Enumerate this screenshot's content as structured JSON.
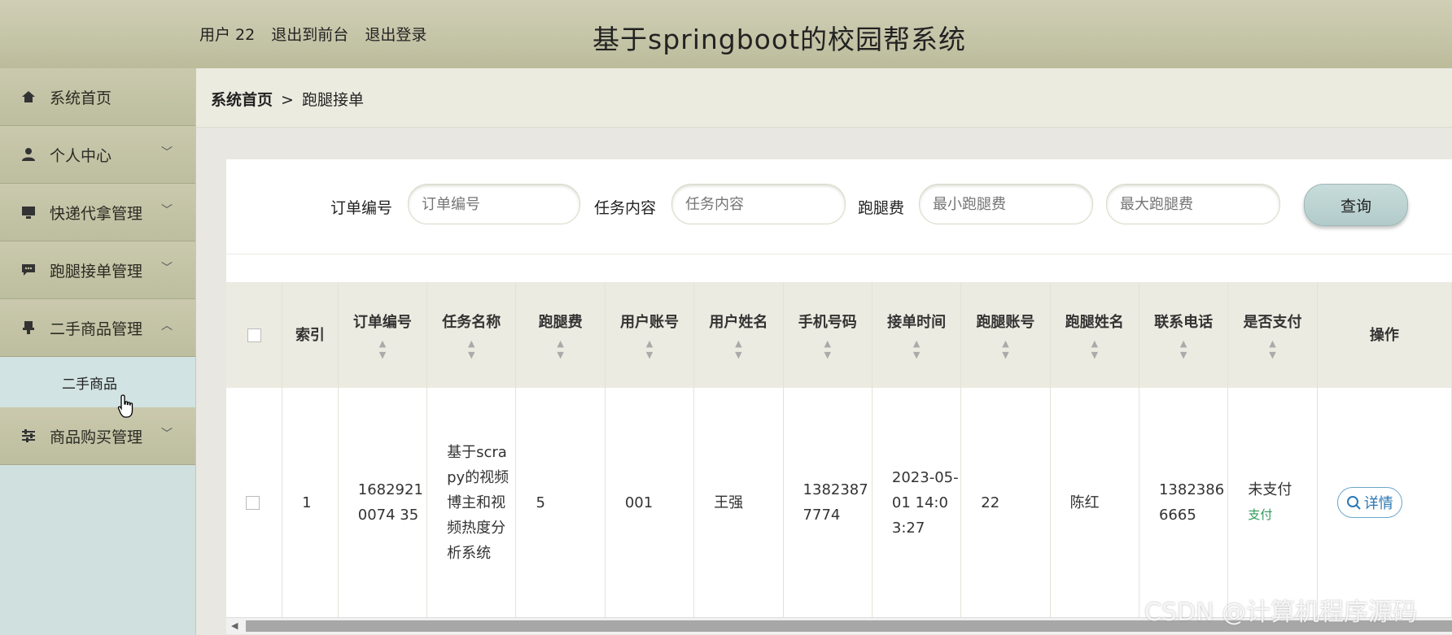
{
  "header": {
    "user_label": "用户 22",
    "back_to_front": "退出到前台",
    "logout": "退出登录",
    "site_title": "基于springboot的校园帮系统"
  },
  "sidebar": {
    "items": [
      {
        "label": "系统首页",
        "icon": "home-icon"
      },
      {
        "label": "个人中心",
        "icon": "user-icon"
      },
      {
        "label": "快递代拿管理",
        "icon": "monitor-icon"
      },
      {
        "label": "跑腿接单管理",
        "icon": "chat-icon"
      },
      {
        "label": "二手商品管理",
        "icon": "stamp-icon"
      },
      {
        "label": "商品购买管理",
        "icon": "sliders-icon"
      }
    ],
    "sub_item": "二手商品"
  },
  "breadcrumb": {
    "home": "系统首页",
    "sep": ">",
    "current": "跑腿接单"
  },
  "search": {
    "order_label": "订单编号",
    "order_placeholder": "订单编号",
    "task_label": "任务内容",
    "task_placeholder": "任务内容",
    "fee_label": "跑腿费",
    "fee_min_placeholder": "最小跑腿费",
    "fee_max_placeholder": "最大跑腿费",
    "query_button": "查询"
  },
  "table": {
    "headers": {
      "index": "索引",
      "order_no": "订单编号",
      "task_name": "任务名称",
      "fee": "跑腿费",
      "user_account": "用户账号",
      "user_name": "用户姓名",
      "phone": "手机号码",
      "accept_time": "接单时间",
      "runner_account": "跑腿账号",
      "runner_name": "跑腿姓名",
      "contact_phone": "联系电话",
      "paid": "是否支付",
      "actions": "操作"
    },
    "rows": [
      {
        "index": "1",
        "order_no": "16829210074 35",
        "task_name": "基于scrapy的视频博主和视频热度分析系统",
        "fee": "5",
        "user_account": "001",
        "user_name": "王强",
        "phone": "13823877774",
        "accept_time": "2023-05-01 14:03:27",
        "runner_account": "22",
        "runner_name": "陈红",
        "contact_phone": "13823866665",
        "paid_status": "未支付",
        "pay_link": "支付",
        "detail_button": "详情"
      }
    ]
  },
  "watermark": "CSDN @计算机程序源码"
}
